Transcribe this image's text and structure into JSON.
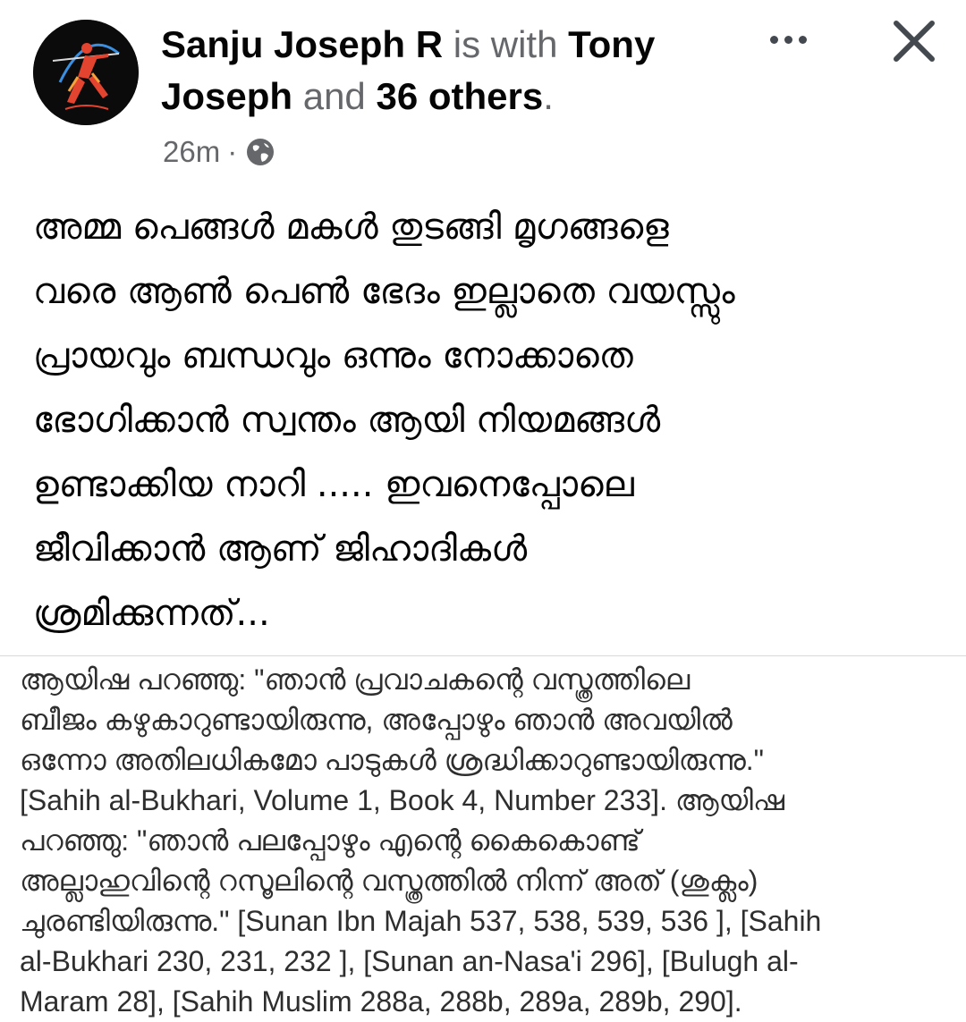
{
  "post": {
    "author": "Sanju Joseph R",
    "with_word": "is with",
    "tagged_first": "Tony",
    "tagged_second": "Joseph",
    "and_word": "and",
    "others": "36 others",
    "period": ".",
    "time": "26m",
    "separator": "·",
    "privacy_icon": "globe-icon",
    "more_icon": "more-horizontal-icon",
    "close_icon": "close-icon",
    "avatar_icon": "archer-figure-avatar"
  },
  "body": {
    "lines": [
      "അമ്മ പെങ്ങൾ മകൾ തുടങ്ങി  മൃഗങ്ങളെ",
      "വരെ ആൺ പെൺ ഭേദം ഇല്ലാതെ വയസ്സും",
      "പ്രായവും ബന്ധവും ഒന്നും നോക്കാതെ",
      "ഭോഗിക്കാൻ സ്വന്തം ആയി നിയമങ്ങൾ",
      "ഉണ്ടാക്കിയ നാറി ..... ഇവനെപ്പോലെ",
      "ജീവിക്കാൻ ആണ് ജിഹാദികൾ",
      "ശ്രമിക്കുന്നത്..."
    ]
  },
  "quote": {
    "lines": [
      "ആയിഷ പറഞ്ഞു: \"ഞാൻ പ്രവാചകന്റെ വസ്ത്രത്തിലെ",
      "ബീജം കഴുകാറുണ്ടായിരുന്നു, അപ്പോഴും ഞാൻ അവയിൽ",
      "ഒന്നോ അതിലധികമോ പാടുകൾ ശ്രദ്ധിക്കാറുണ്ടായിരുന്നു.\"",
      "[Sahih al-Bukhari, Volume 1, Book 4, Number 233]. ആയിഷ",
      "പറഞ്ഞു: \"ഞാൻ പലപ്പോഴും എന്റെ കൈകൊണ്ട്",
      "അല്ലാഹുവിന്റെ റസൂലിന്റെ വസ്ത്രത്തിൽ നിന്ന് അത് (ശുക്ലം)",
      "ചുരണ്ടിയിരുന്നു.\" [Sunan Ibn Majah 537, 538, 539, 536 ],  [Sahih",
      "al-Bukhari 230, 231, 232 ], [Sunan an-Nasa'i 296], [Bulugh al-",
      "Maram 28], [Sahih Muslim 288a, 288b, 289a, 289b, 290]."
    ]
  }
}
